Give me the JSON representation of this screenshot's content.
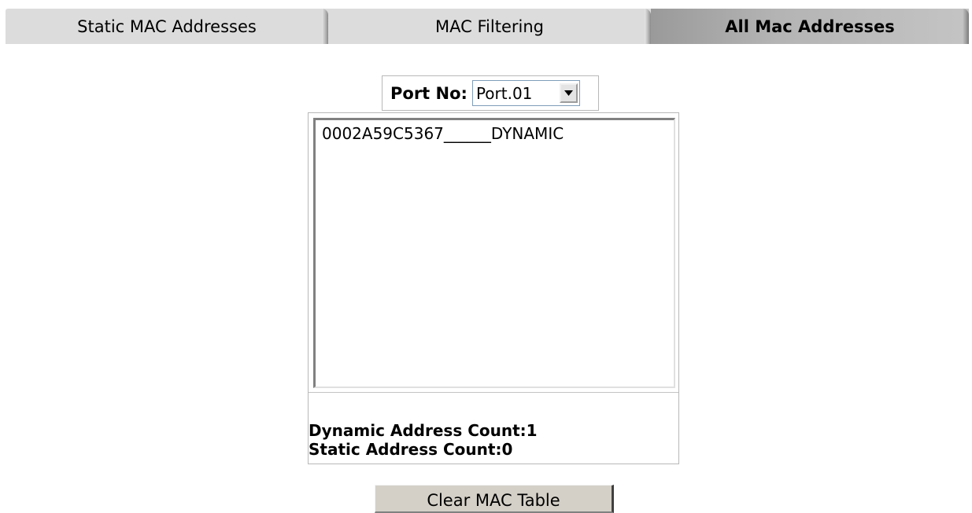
{
  "tabs": [
    {
      "label": "Static MAC Addresses",
      "active": false
    },
    {
      "label": "MAC Filtering",
      "active": false
    },
    {
      "label": "All Mac Addresses",
      "active": true
    }
  ],
  "port": {
    "label": "Port No:",
    "selected": "Port.01",
    "icon": "chevron-down-icon"
  },
  "mac_list": {
    "items": [
      "0002A59C5367______DYNAMIC"
    ]
  },
  "counts": {
    "dynamic": "Dynamic Address Count:1",
    "static": "Static Address Count:0"
  },
  "clear_button_label": "Clear MAC Table",
  "colors": {
    "tab_inactive": "#dcdcdc",
    "tab_active": "#b4b4b4",
    "button_face": "#d4d0c8",
    "select_border": "#7f9db9"
  }
}
